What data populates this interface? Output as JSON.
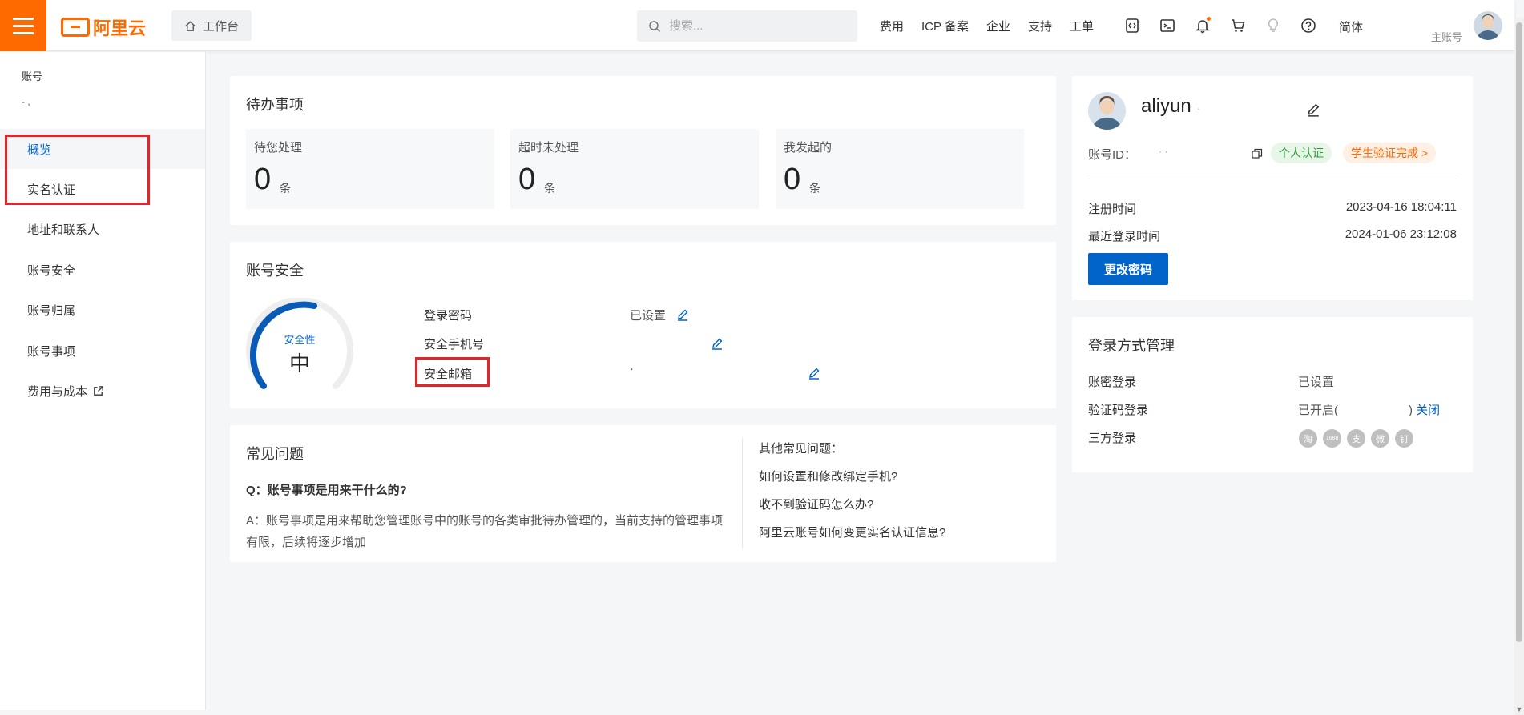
{
  "header": {
    "logo_text": "阿里云",
    "workbench_label": "工作台",
    "search_placeholder": "搜索...",
    "nav_links": [
      "费用",
      "ICP 备案",
      "企业",
      "支持",
      "工单"
    ],
    "lang_label": "简体",
    "account_label": "主账号",
    "accent_color": "#ff6a00"
  },
  "sidebar": {
    "title": "账号",
    "subtitle": "- ,",
    "items": [
      {
        "label": "概览",
        "active": true
      },
      {
        "label": "实名认证"
      },
      {
        "label": "地址和联系人"
      },
      {
        "label": "账号安全"
      },
      {
        "label": "账号归属"
      },
      {
        "label": "账号事项"
      },
      {
        "label": "费用与成本",
        "icon": "external-link-icon"
      }
    ]
  },
  "todo": {
    "title": "待办事项",
    "boxes": [
      {
        "label": "待您处理",
        "count": "0",
        "unit": "条"
      },
      {
        "label": "超时未处理",
        "count": "0",
        "unit": "条"
      },
      {
        "label": "我发起的",
        "count": "0",
        "unit": "条"
      }
    ]
  },
  "security": {
    "title": "账号安全",
    "gauge_label": "安全性",
    "gauge_value": "中",
    "gauge_fraction": 0.5,
    "rows": [
      {
        "label": "登录密码",
        "value": "已设置"
      },
      {
        "label": "安全手机号",
        "value": ""
      },
      {
        "label": "安全邮箱",
        "value": "·"
      }
    ]
  },
  "faq": {
    "title": "常见问题",
    "question": "Q：账号事项是用来干什么的?",
    "answer": "A：账号事项是用来帮助您管理账号中的账号的各类审批待办管理的，当前支持的管理事项有限，后续将逐步增加",
    "other_title": "其他常见问题：",
    "links": [
      "如何设置和修改绑定手机?",
      "收不到验证码怎么办?",
      "阿里云账号如何变更实名认证信息?"
    ]
  },
  "profile": {
    "name": "aliyun",
    "name_tail": "·",
    "id_label": "账号ID：",
    "id_value": "·  ·",
    "badge_personal": "个人认证",
    "badge_student": "学生验证完成 >",
    "register_label": "注册时间",
    "register_value": "2023-04-16 18:04:11",
    "last_login_label": "最近登录时间",
    "last_login_value": "2024-01-06 23:12:08",
    "change_pwd_label": "更改密码"
  },
  "login_mgmt": {
    "title": "登录方式管理",
    "pwd_label": "账密登录",
    "pwd_value": "已设置",
    "code_label": "验证码登录",
    "code_value_prefix": "已开启(",
    "code_value_suffix": ")",
    "code_close_link": "关闭",
    "third_label": "三方登录",
    "third_icons": [
      {
        "name": "taobao-icon",
        "glyph": "淘"
      },
      {
        "name": "1688-icon",
        "glyph": "1688"
      },
      {
        "name": "alipay-icon",
        "glyph": "支"
      },
      {
        "name": "weibo-icon",
        "glyph": "微"
      },
      {
        "name": "dingtalk-icon",
        "glyph": "钉"
      }
    ]
  }
}
